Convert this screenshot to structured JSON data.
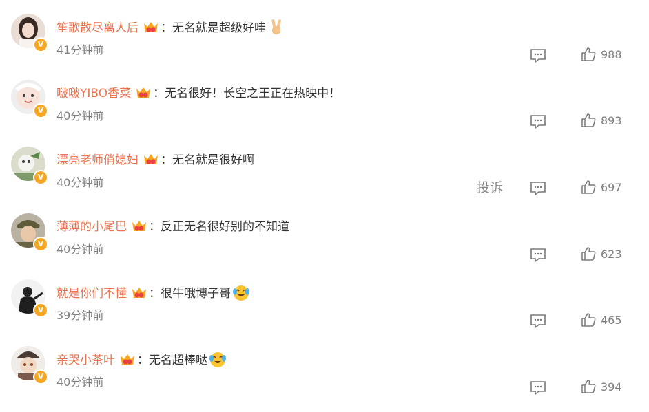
{
  "comments": [
    {
      "username": "笙歌散尽离人后",
      "colon": "：",
      "text": "无名就是超级好哇",
      "emoji": "victory-hand-emoji",
      "time": "41分钟前",
      "likes": "988",
      "show_report": false
    },
    {
      "username": "啵啵YIBO香菜",
      "colon": "：",
      "text": "无名很好！长空之王正在热映中！",
      "emoji": "",
      "time": "40分钟前",
      "likes": "893",
      "show_report": false
    },
    {
      "username": "漂亮老师俏媳妇",
      "colon": "：",
      "text": "无名就是很好啊",
      "emoji": "",
      "time": "40分钟前",
      "likes": "697",
      "show_report": true,
      "report_label": "投诉"
    },
    {
      "username": "薄薄的小尾巴",
      "colon": "：",
      "text": "反正无名很好别的不知道",
      "emoji": "",
      "time": "40分钟前",
      "likes": "623",
      "show_report": false
    },
    {
      "username": "就是你们不懂",
      "colon": "：",
      "text": "很牛哦博子哥",
      "emoji": "crying-laughing-emoji",
      "time": "39分钟前",
      "likes": "465",
      "show_report": false
    },
    {
      "username": "亲哭小茶叶",
      "colon": "：",
      "text": "无名超棒哒",
      "emoji": "crying-laughing-emoji",
      "time": "40分钟前",
      "likes": "394",
      "show_report": false
    }
  ],
  "colors": {
    "username": "#eb7350",
    "text": "#333333",
    "meta": "#808080",
    "badge": "#f5a623"
  },
  "icons": {
    "verified": "verified-badge-icon",
    "crown": "member-crown-icon",
    "reply": "comment-reply-icon",
    "like": "thumbs-up-icon"
  }
}
